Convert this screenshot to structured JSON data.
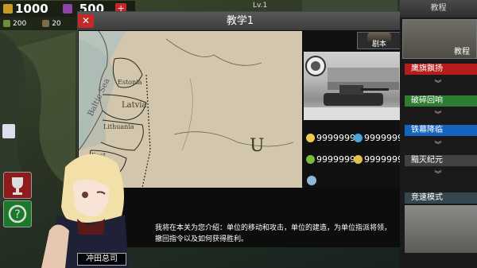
{
  "resources": {
    "gold": "1000",
    "medals": "500",
    "plus": "+",
    "res1": "200",
    "res2": "20"
  },
  "hud": {
    "level": "Lv.1"
  },
  "dialog": {
    "title": "教学1",
    "close_icon": "✕",
    "script_tab": "剧本",
    "map_labels": {
      "sea": "Baltic Sea",
      "estonia": "Estonia",
      "latvia": "Latvia",
      "lithuania": "Lithuania",
      "east_prussia": "East Prussia",
      "ussr": "U"
    },
    "stats": [
      "9999999",
      "9999999",
      "9999999",
      "9999999"
    ],
    "message": "我将在本关为您介绍：单位的移动和攻击，单位的建造，为单位指派将领，撤回指令以及如何获得胜利。"
  },
  "character": {
    "name": "冲田总司"
  },
  "sidebar": {
    "title": "教程",
    "tutorial_label": "教程",
    "items": [
      {
        "label": "鹰旗飘扬",
        "color": "#b71c1c"
      },
      {
        "label": "破碎回响",
        "color": "#2e7d32"
      },
      {
        "label": "铁幕降临",
        "color": "#1565c0"
      },
      {
        "label": "黯灭纪元",
        "color": "#424242"
      },
      {
        "label": "竞速模式",
        "color": "#37474f"
      }
    ]
  }
}
